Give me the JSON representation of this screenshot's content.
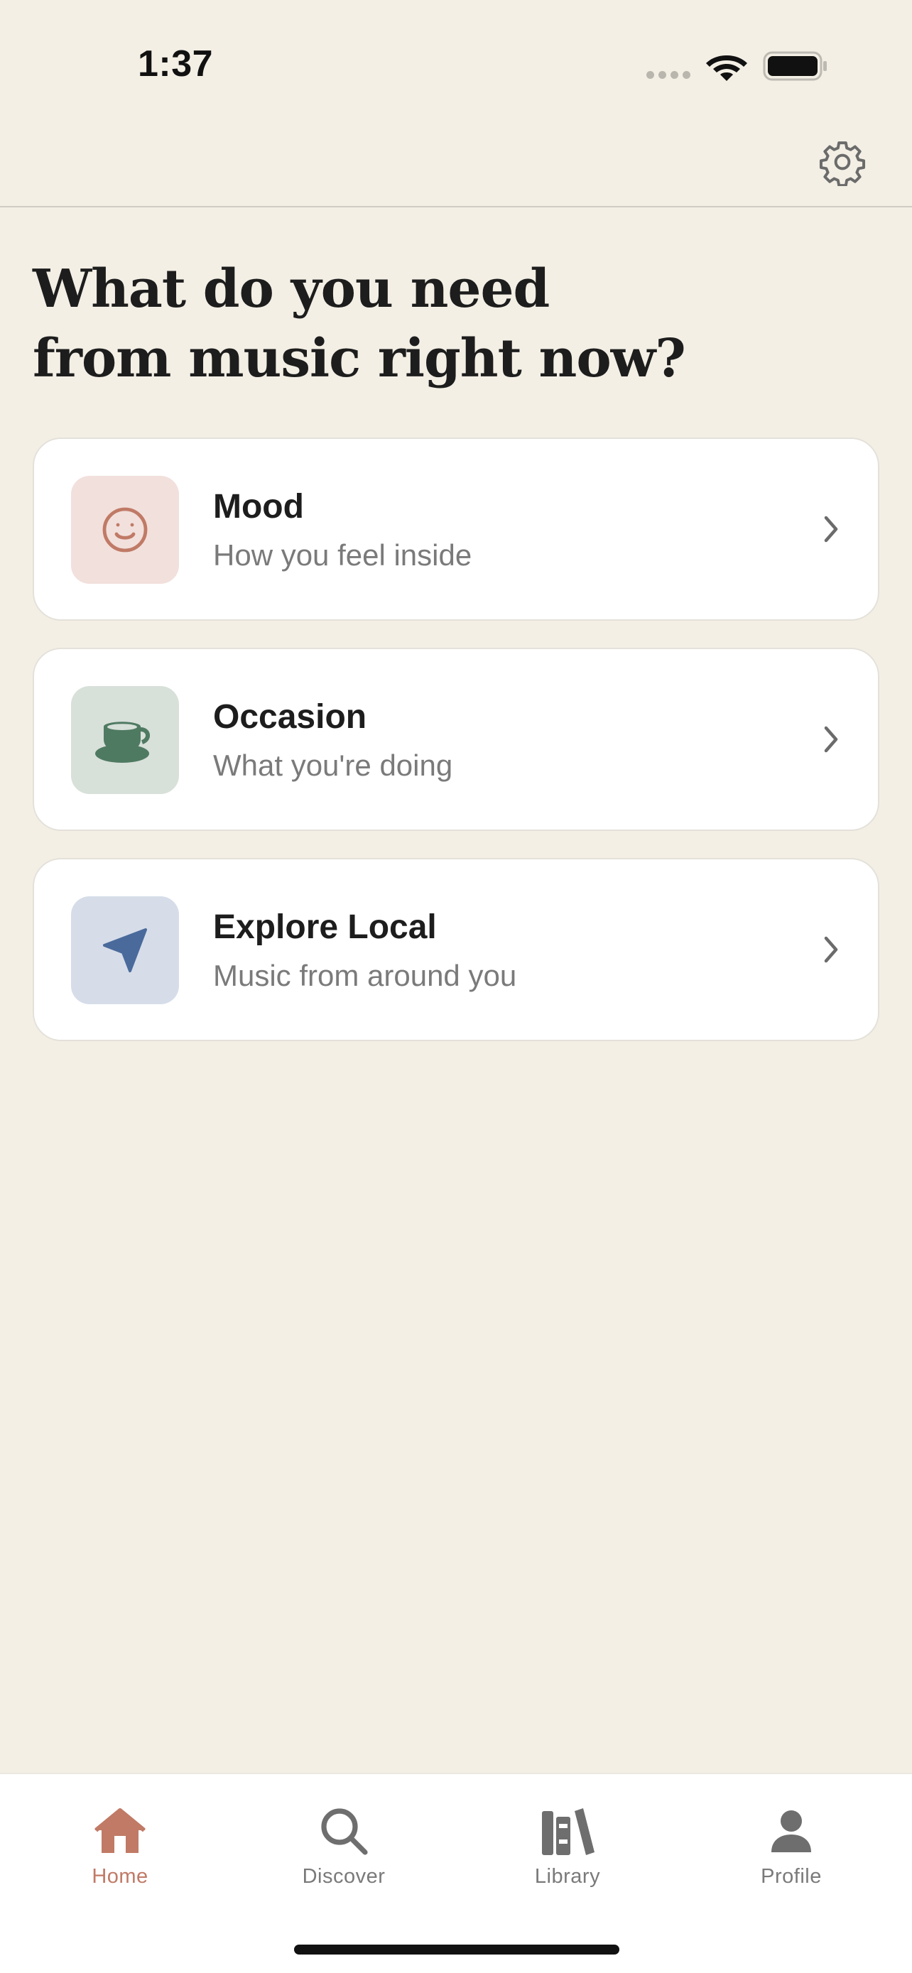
{
  "status_bar": {
    "time": "1:37"
  },
  "header": {
    "settings_icon": "gear-icon"
  },
  "page": {
    "title_line1": "What do you need",
    "title_line2": "from music right now?"
  },
  "cards": [
    {
      "title": "Mood",
      "subtitle": "How you feel inside",
      "icon": "smiley-face-icon",
      "icon_bg": "#f2e0dc",
      "icon_color": "#c07a66"
    },
    {
      "title": "Occasion",
      "subtitle": "What you're doing",
      "icon": "coffee-cup-icon",
      "icon_bg": "#d8e0da",
      "icon_color": "#4f7a62"
    },
    {
      "title": "Explore Local",
      "subtitle": "Music from around you",
      "icon": "location-arrow-icon",
      "icon_bg": "#d6dde9",
      "icon_color": "#4a6a9c"
    }
  ],
  "tab_bar": {
    "tabs": [
      {
        "label": "Home",
        "icon": "home-icon",
        "active": true
      },
      {
        "label": "Discover",
        "icon": "magnifier-icon",
        "active": false
      },
      {
        "label": "Library",
        "icon": "books-icon",
        "active": false
      },
      {
        "label": "Profile",
        "icon": "person-icon",
        "active": false
      }
    ],
    "active_color": "#c07a66",
    "inactive_color": "#6e6e6e"
  }
}
